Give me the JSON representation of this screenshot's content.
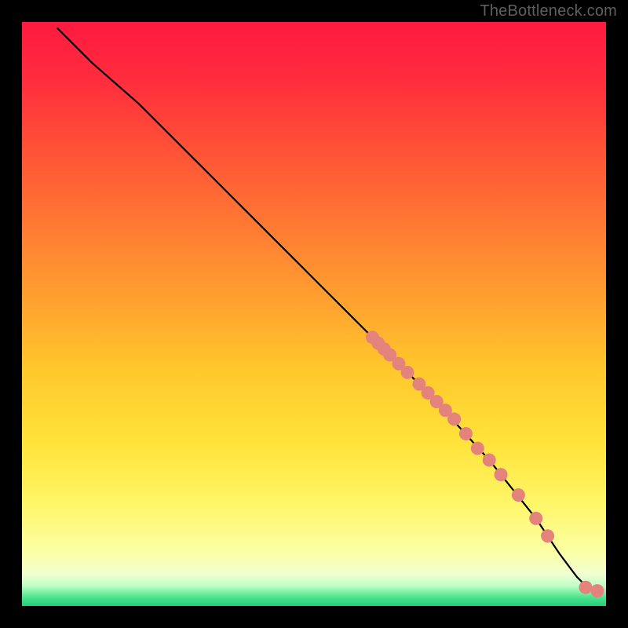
{
  "attribution": "TheBottleneck.com",
  "palette": {
    "background": "#000000",
    "gradient_stops": [
      {
        "pos": 0.0,
        "color": "#ff1a3f"
      },
      {
        "pos": 0.1,
        "color": "#ff2d3d"
      },
      {
        "pos": 0.22,
        "color": "#ff5236"
      },
      {
        "pos": 0.35,
        "color": "#ff7a33"
      },
      {
        "pos": 0.48,
        "color": "#ffa22f"
      },
      {
        "pos": 0.6,
        "color": "#ffc92b"
      },
      {
        "pos": 0.72,
        "color": "#ffe33a"
      },
      {
        "pos": 0.82,
        "color": "#fff566"
      },
      {
        "pos": 0.9,
        "color": "#fcff9e"
      },
      {
        "pos": 0.945,
        "color": "#f2ffd0"
      },
      {
        "pos": 0.965,
        "color": "#bfffc7"
      },
      {
        "pos": 0.985,
        "color": "#4de38e"
      },
      {
        "pos": 1.0,
        "color": "#20d07a"
      }
    ],
    "curve": "#000000",
    "marker": "#e4837b"
  },
  "chart_data": {
    "type": "line",
    "title": "",
    "xlabel": "",
    "ylabel": "",
    "xlim": [
      0,
      100
    ],
    "ylim": [
      0,
      100
    ],
    "series": [
      {
        "name": "bottleneck-curve",
        "x": [
          6,
          8,
          12,
          20,
          30,
          40,
          50,
          60,
          70,
          80,
          88,
          92,
          95,
          97,
          98.5
        ],
        "y": [
          99,
          97,
          93,
          86,
          76,
          66,
          56,
          46,
          36,
          25,
          15,
          9,
          5,
          3,
          2.5
        ]
      }
    ],
    "markers": {
      "name": "highlighted-points",
      "x": [
        60,
        61,
        62,
        63,
        64.5,
        66,
        68,
        69.5,
        71,
        72.5,
        74,
        76,
        78,
        80,
        82,
        85,
        88,
        90,
        96.5,
        98.5
      ],
      "y": [
        46,
        45,
        44,
        43,
        41.5,
        40,
        38,
        36.5,
        35,
        33.5,
        32,
        29.5,
        27,
        25,
        22.5,
        19,
        15,
        12,
        3.2,
        2.6
      ]
    }
  }
}
